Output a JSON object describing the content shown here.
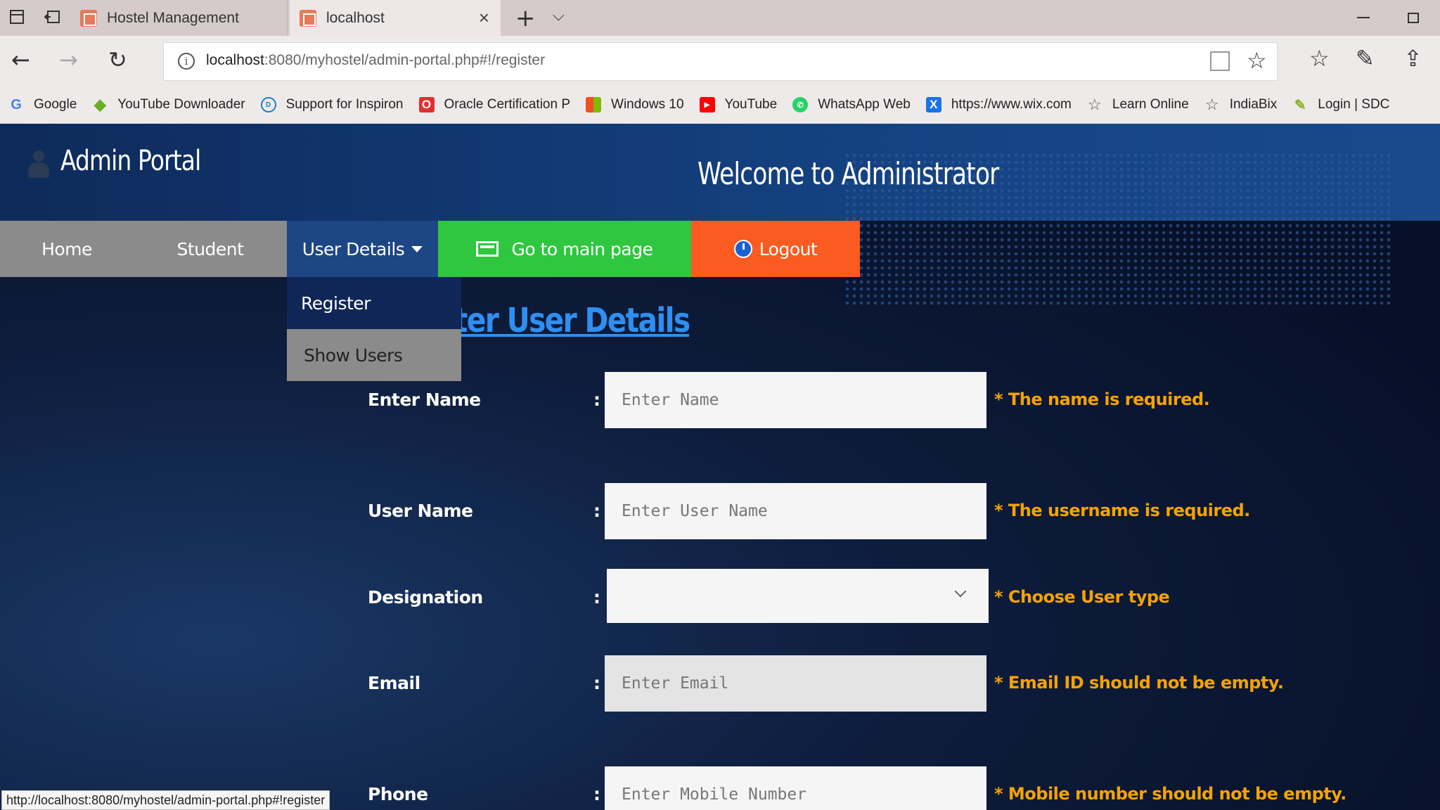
{
  "browser": {
    "tabs": [
      {
        "label": "Hostel Management"
      },
      {
        "label": "localhost"
      }
    ],
    "address": {
      "host": "localhost",
      "rest": ":8080/myhostel/admin-portal.php#!/register"
    },
    "bookmarks": [
      {
        "label": "Google",
        "icon": "google-icon",
        "color": "#4285f4"
      },
      {
        "label": "YouTube Downloader",
        "icon": "download-icon",
        "color": "#6ab023"
      },
      {
        "label": "Support for Inspiron",
        "icon": "dell-icon",
        "color": "#1a7ec8"
      },
      {
        "label": "Oracle Certification P",
        "icon": "oracle-icon",
        "color": "#e0312e"
      },
      {
        "label": "Windows 10",
        "icon": "windows-icon",
        "color": "#f25022"
      },
      {
        "label": "YouTube",
        "icon": "youtube-icon",
        "color": "#ff0000"
      },
      {
        "label": "WhatsApp Web",
        "icon": "whatsapp-icon",
        "color": "#25d366"
      },
      {
        "label": "https://www.wix.com",
        "icon": "wix-icon",
        "color": "#1a73e8"
      },
      {
        "label": "Learn Online",
        "icon": "star-icon",
        "color": "#555555"
      },
      {
        "label": "IndiaBix",
        "icon": "star-icon",
        "color": "#555555"
      },
      {
        "label": "Login | SDC",
        "icon": "sdc-icon",
        "color": "#8ab42a"
      }
    ],
    "status_url": "http://localhost:8080/myhostel/admin-portal.php#!register"
  },
  "header": {
    "portal_title": "Admin Portal",
    "welcome": "Welcome to Administrator"
  },
  "menu": {
    "home": "Home",
    "student": "Student",
    "user_details": "User Details",
    "go_main": "Go to main page",
    "logout": "Logout"
  },
  "dropdown": {
    "register": "Register",
    "show_users": "Show Users"
  },
  "form": {
    "title": "Register User Details",
    "name": {
      "label": "Enter Name",
      "placeholder": "Enter Name",
      "error": "* The name is required."
    },
    "username": {
      "label": "User Name",
      "placeholder": "Enter User Name",
      "error": "* The username is required."
    },
    "designation": {
      "label": "Designation",
      "error": "* Choose User type"
    },
    "email": {
      "label": "Email",
      "placeholder": "Enter Email",
      "error": "* Email ID should not be empty."
    },
    "phone": {
      "label": "Phone",
      "placeholder": "Enter Mobile Number",
      "error": "* Mobile number should not be empty."
    },
    "colon": ":"
  },
  "colors": {
    "accent_green": "#2ec73f",
    "accent_orange": "#fa5b20",
    "error_text": "#f5a300",
    "title_link": "#2e8ff0"
  }
}
